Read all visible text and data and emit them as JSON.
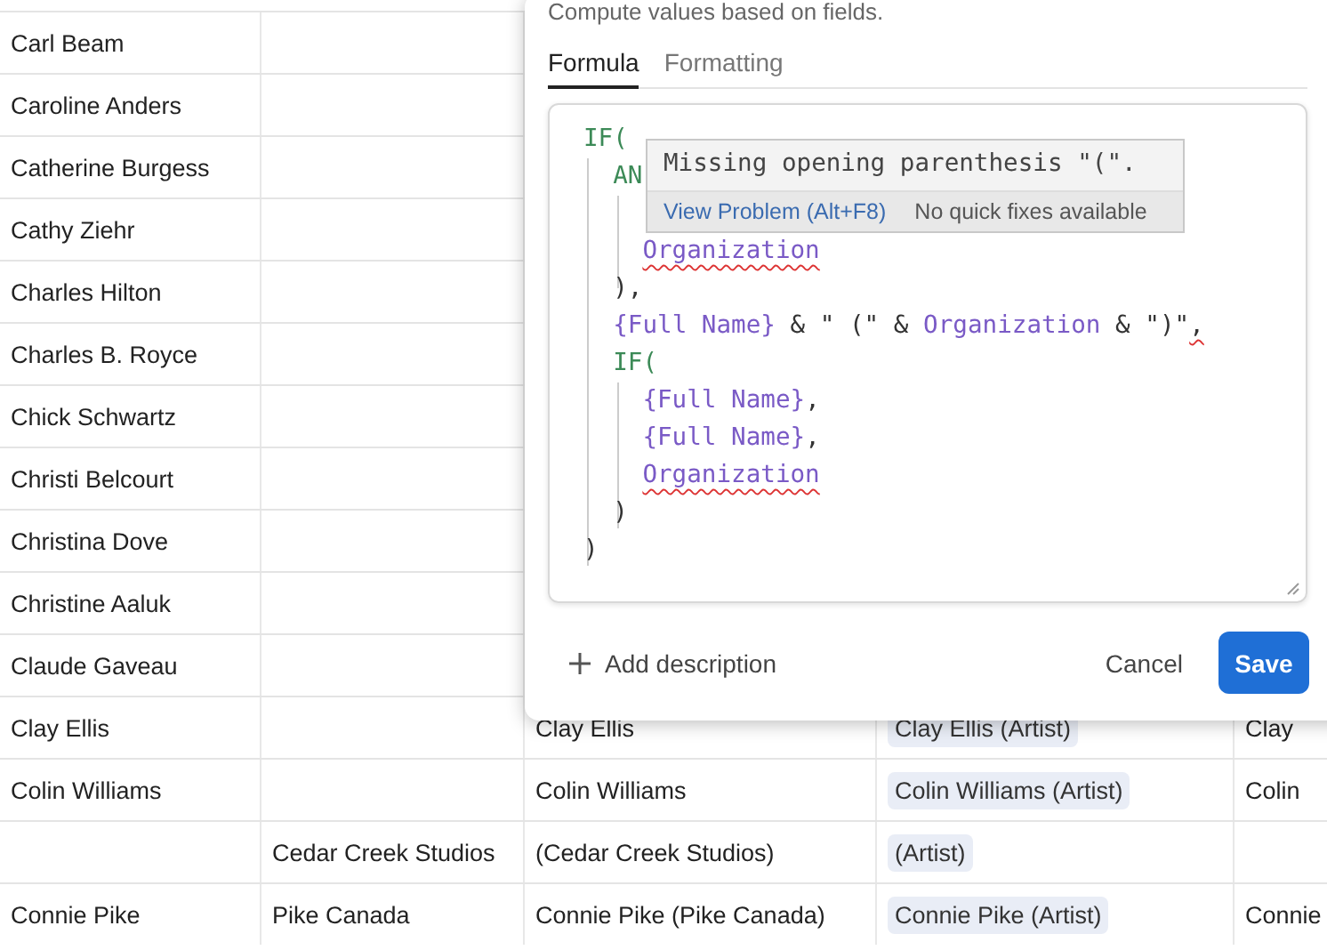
{
  "table": {
    "rows": [
      {
        "cells": [
          "Carl Beam",
          ""
        ]
      },
      {
        "cells": [
          "Caroline Anders",
          ""
        ]
      },
      {
        "cells": [
          "Catherine Burgess",
          ""
        ]
      },
      {
        "cells": [
          "Cathy Ziehr",
          ""
        ]
      },
      {
        "cells": [
          "Charles Hilton",
          ""
        ]
      },
      {
        "cells": [
          "Charles B. Royce",
          ""
        ]
      },
      {
        "cells": [
          "Chick Schwartz",
          ""
        ]
      },
      {
        "cells": [
          "Christi Belcourt",
          ""
        ]
      },
      {
        "cells": [
          "Christina Dove",
          ""
        ]
      },
      {
        "cells": [
          "Christine Aaluk",
          ""
        ]
      },
      {
        "cells": [
          "Claude Gaveau",
          ""
        ]
      },
      {
        "cells": [
          "Clay Ellis",
          "",
          "Clay Ellis",
          "Clay Ellis (Artist)",
          "Clay"
        ]
      },
      {
        "cells": [
          "Colin Williams",
          "",
          "Colin Williams",
          "Colin Williams (Artist)",
          "Colin"
        ]
      },
      {
        "cells": [
          "",
          "Cedar Creek Studios",
          "(Cedar Creek Studios)",
          "(Artist)",
          ""
        ]
      },
      {
        "cells": [
          "Connie Pike",
          "Pike Canada",
          "Connie Pike (Pike Canada)",
          "Connie Pike (Artist)",
          "Connie"
        ]
      }
    ]
  },
  "dialog": {
    "description": "Compute values based on fields.",
    "tabs": [
      {
        "label": "Formula",
        "selected": true
      },
      {
        "label": "Formatting",
        "selected": false
      }
    ],
    "code_lines": [
      {
        "tokens": [
          {
            "kind": "func",
            "text": "IF("
          }
        ]
      },
      {
        "tokens": [
          {
            "kind": "func",
            "text": "AN"
          }
        ]
      },
      {
        "tokens": [
          {
            "kind": "field",
            "text": "Organization",
            "error": true
          }
        ]
      },
      {
        "tokens": [
          {
            "kind": "plain",
            "text": "),"
          }
        ]
      },
      {
        "tokens": [
          {
            "kind": "field",
            "text": "{Full Name}"
          },
          {
            "kind": "plain",
            "text": " & \" (\" & "
          },
          {
            "kind": "field",
            "text": "Organization"
          },
          {
            "kind": "plain",
            "text": " & \")\""
          },
          {
            "kind": "plain",
            "text": ",",
            "error": true
          }
        ]
      },
      {
        "tokens": [
          {
            "kind": "func",
            "text": "IF("
          }
        ]
      },
      {
        "tokens": [
          {
            "kind": "field",
            "text": "{Full Name}"
          },
          {
            "kind": "plain",
            "text": ","
          }
        ]
      },
      {
        "tokens": [
          {
            "kind": "field",
            "text": "{Full Name}"
          },
          {
            "kind": "plain",
            "text": ","
          }
        ]
      },
      {
        "tokens": [
          {
            "kind": "field",
            "text": "Organization",
            "error": true
          }
        ]
      },
      {
        "tokens": [
          {
            "kind": "plain",
            "text": ")"
          }
        ]
      },
      {
        "tokens": [
          {
            "kind": "plain",
            "text": ")"
          }
        ]
      }
    ],
    "hover": {
      "message": "Missing opening parenthesis \"(\".",
      "action": "View Problem (Alt+F8)",
      "note": "No quick fixes available"
    },
    "add_description": "Add description",
    "cancel": "Cancel",
    "save": "Save"
  }
}
